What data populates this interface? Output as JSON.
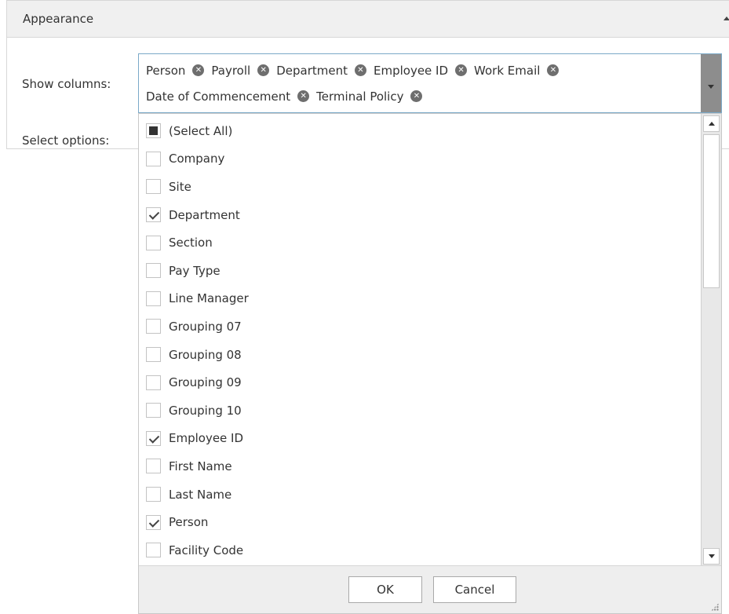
{
  "panel": {
    "title": "Appearance"
  },
  "form": {
    "show_columns_label": "Show columns:",
    "select_options_label": "Select options:"
  },
  "tags": [
    "Person",
    "Payroll",
    "Department",
    "Employee ID",
    "Work Email",
    "Date of Commencement",
    "Terminal Policy"
  ],
  "list": {
    "items": [
      {
        "label": "(Select All)",
        "state": "indeterminate"
      },
      {
        "label": "Company",
        "state": "unchecked"
      },
      {
        "label": "Site",
        "state": "unchecked"
      },
      {
        "label": "Department",
        "state": "checked"
      },
      {
        "label": "Section",
        "state": "unchecked"
      },
      {
        "label": "Pay Type",
        "state": "unchecked"
      },
      {
        "label": "Line Manager",
        "state": "unchecked"
      },
      {
        "label": "Grouping 07",
        "state": "unchecked"
      },
      {
        "label": "Grouping 08",
        "state": "unchecked"
      },
      {
        "label": "Grouping 09",
        "state": "unchecked"
      },
      {
        "label": "Grouping 10",
        "state": "unchecked"
      },
      {
        "label": "Employee ID",
        "state": "checked"
      },
      {
        "label": "First Name",
        "state": "unchecked"
      },
      {
        "label": "Last Name",
        "state": "unchecked"
      },
      {
        "label": "Person",
        "state": "checked"
      },
      {
        "label": "Facility Code",
        "state": "unchecked"
      }
    ]
  },
  "footer": {
    "ok_label": "OK",
    "cancel_label": "Cancel"
  },
  "colors": {
    "accent_border": "#7aa9c8",
    "header_bg": "#f0f0f0",
    "footer_bg": "#eeeeee"
  },
  "icons": {
    "tag_remove": "close-circle-icon",
    "dropdown": "chevron-down-icon",
    "collapse": "chevron-up-icon",
    "resize": "resize-grip-icon"
  }
}
